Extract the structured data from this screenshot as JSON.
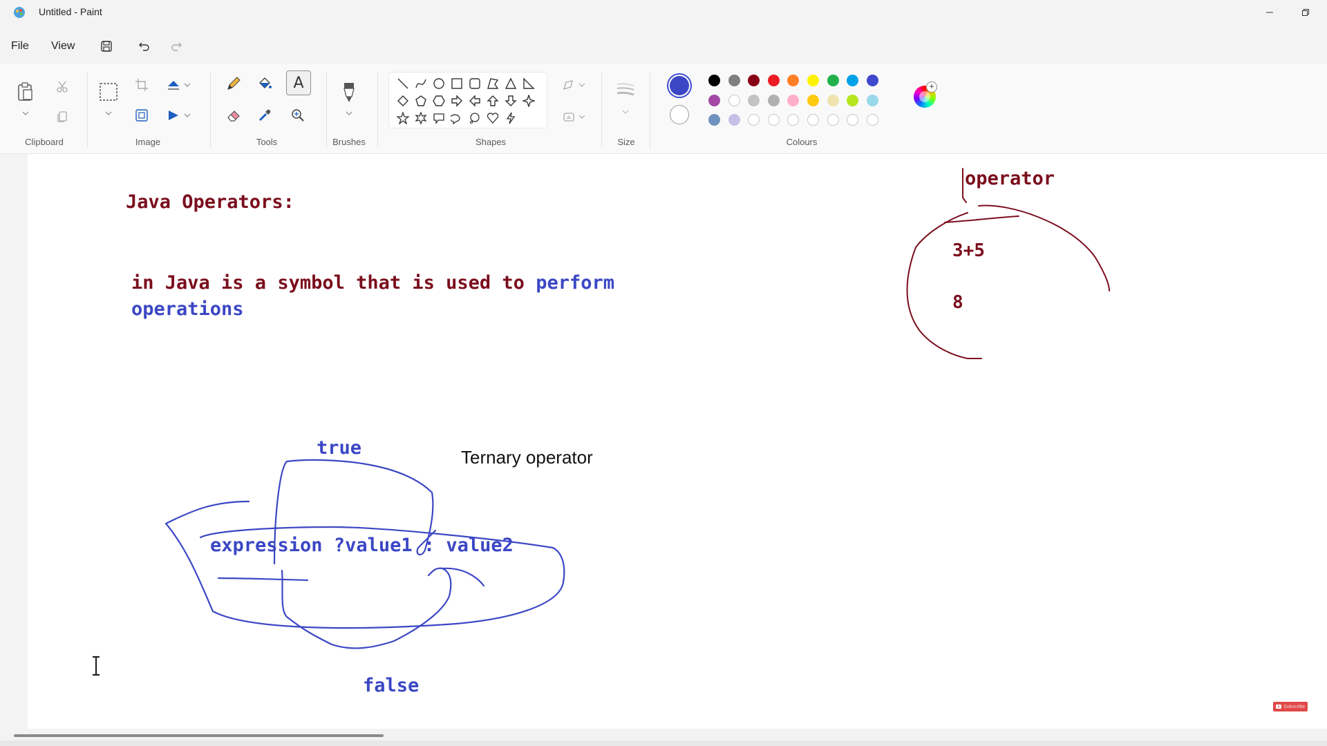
{
  "window": {
    "title": "Untitled - Paint"
  },
  "menu": {
    "file": "File",
    "view": "View"
  },
  "ribbon": {
    "groups": {
      "clipboard": "Clipboard",
      "image": "Image",
      "tools": "Tools",
      "brushes": "Brushes",
      "shapes": "Shapes",
      "size": "Size",
      "colours": "Colours"
    },
    "icons": {
      "text_tool": "A"
    },
    "primary_color": "#3b47c4",
    "secondary_color": "#ffffff",
    "palette_row1": [
      "#000000",
      "#7f7f7f",
      "#880015",
      "#ed1c24",
      "#ff7f27",
      "#fff200",
      "#22b14c",
      "#00a2e8",
      "#3f48cc"
    ],
    "palette_row2": [
      "#a349a4",
      "#ffffff",
      "#c3c3c3",
      "#b0b0b0",
      "#ffaec9",
      "#ffc90e",
      "#efe4b0",
      "#b5e61d",
      "#99d9ea"
    ],
    "palette_row3": [
      "#7092be",
      "#c8bfe7",
      "",
      "",
      "",
      "",
      "",
      "",
      ""
    ]
  },
  "canvas": {
    "heading": "Java Operators:",
    "definition_line1_maroon": "in Java is a symbol that is used to ",
    "definition_line1_blue": "perform",
    "definition_line2": "operations",
    "ternary_label": "Ternary operator",
    "true_label": "true",
    "expression": "expression ?value1 : value2",
    "false_label": "false",
    "operator_label": "operator",
    "sum_expression": "3+5",
    "sum_result": "8",
    "ink_blue": "#3b47c4",
    "ink_maroon": "#7b0e1d"
  },
  "overlay": {
    "subscribe_badge": "Subscribe"
  }
}
